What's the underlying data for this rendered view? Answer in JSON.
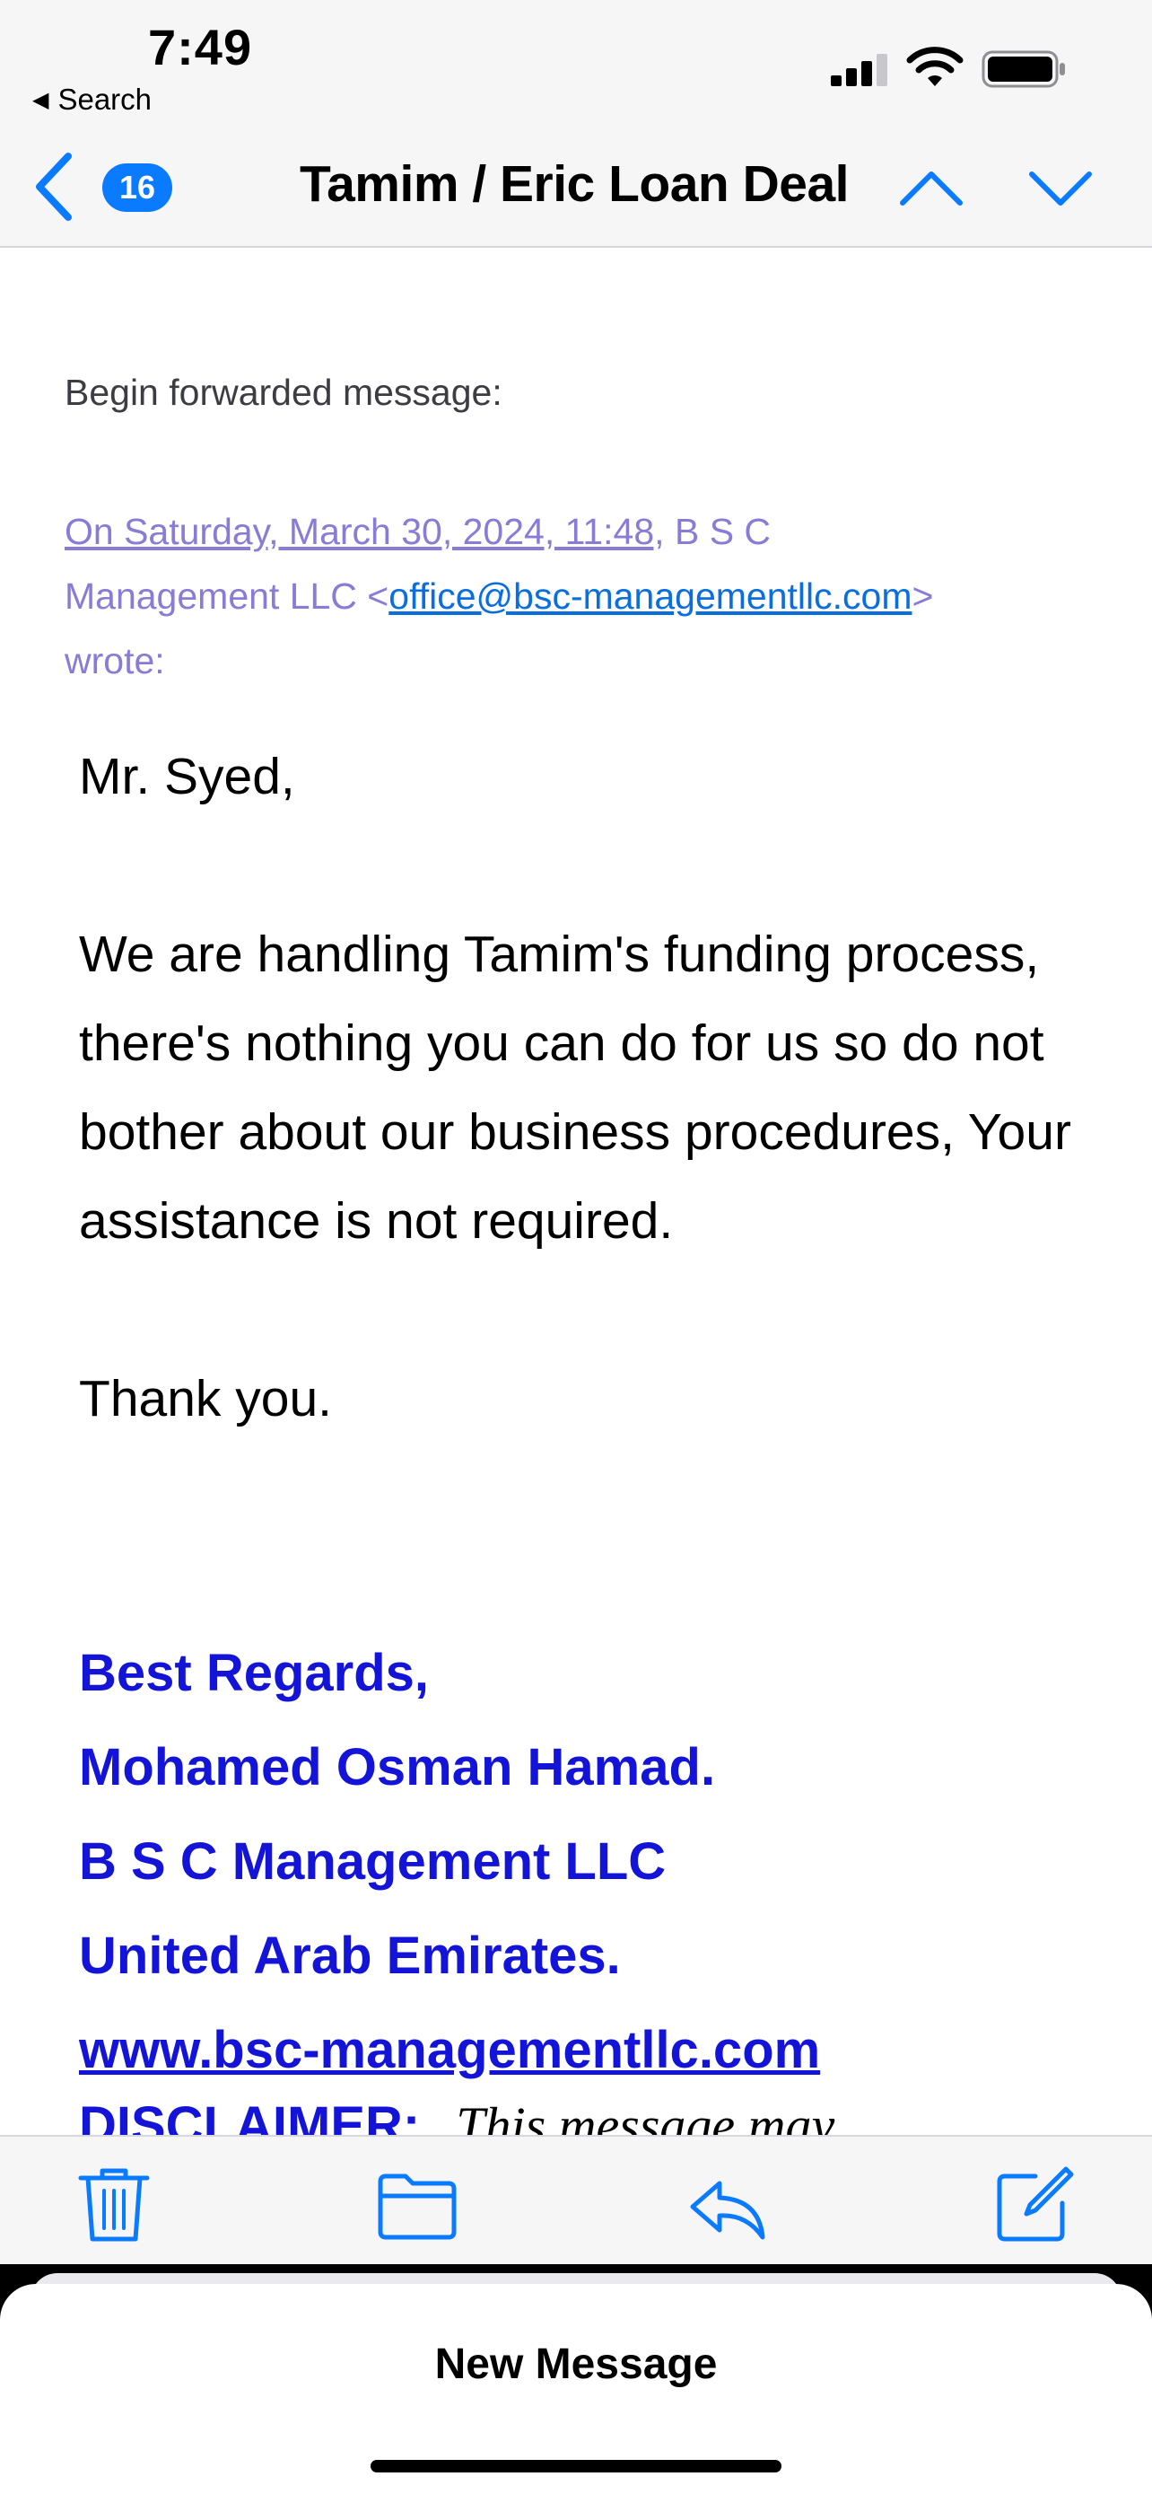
{
  "status_bar": {
    "time": "7:49",
    "back_app": "Search",
    "icons": [
      "cellular-signal-icon",
      "wifi-icon",
      "battery-icon"
    ]
  },
  "nav_bar": {
    "back_icon": "chevron-left-icon",
    "unread_count": "16",
    "title": "Tamim / Eric Loan Deal",
    "prev_icon": "chevron-up-icon",
    "next_icon": "chevron-down-icon"
  },
  "email": {
    "forward_label": "Begin forwarded message:",
    "meta_date": "On Saturday, March 30, 2024, 11:48,",
    "meta_sender_start": " B S C",
    "meta_sender_end": "Management LLC <",
    "meta_email": "office@bsc-managementllc.com",
    "meta_close": ">",
    "meta_wrote": "wrote:",
    "greeting": "Mr. Syed,",
    "paragraph": "We are handling Tamim's funding process, there's nothing you can do for us so do not bother about our business procedures, Your assistance is not required.",
    "thanks": "Thank you.",
    "signature": {
      "line1": "Best Regards,",
      "line2": "Mohamed Osman Hamad.",
      "line3": "B S C Management LLC",
      "line4": "United Arab Emirates.",
      "website": "www.bsc-managementllc.com"
    },
    "disclaimer_label": "DISCLAIMER:",
    "disclaimer_text": "This message may"
  },
  "toolbar": {
    "icons": [
      "trash-icon",
      "folder-icon",
      "reply-icon",
      "compose-icon"
    ]
  },
  "sheet": {
    "title": "New Message"
  },
  "colors": {
    "ios_blue": "#0a7bff",
    "meta_purple": "#8a7bd6",
    "signature_blue": "#1414d8",
    "bar_background": "#f6f6f6"
  }
}
